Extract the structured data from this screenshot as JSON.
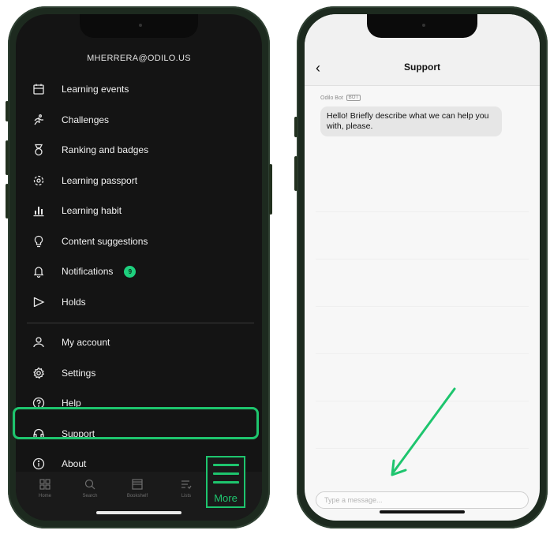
{
  "left_screen": {
    "account_email": "MHERRERA@ODILO.US",
    "menu_items": [
      {
        "label": "Learning events",
        "icon": "calendar-icon"
      },
      {
        "label": "Challenges",
        "icon": "runner-icon"
      },
      {
        "label": "Ranking and badges",
        "icon": "medal-icon"
      },
      {
        "label": "Learning passport",
        "icon": "passport-icon"
      },
      {
        "label": "Learning habit",
        "icon": "bar-chart-icon"
      },
      {
        "label": "Content suggestions",
        "icon": "lightbulb-icon"
      },
      {
        "label": "Notifications",
        "icon": "bell-icon",
        "badge": "9"
      },
      {
        "label": "Holds",
        "icon": "flag-icon"
      }
    ],
    "account_items": [
      {
        "label": "My account",
        "icon": "user-icon"
      },
      {
        "label": "Settings",
        "icon": "gear-icon"
      },
      {
        "label": "Help",
        "icon": "help-icon"
      },
      {
        "label": "Support",
        "icon": "headset-icon"
      },
      {
        "label": "About",
        "icon": "info-icon"
      }
    ],
    "tabs": [
      {
        "label": "Home",
        "icon": "home-grid-icon"
      },
      {
        "label": "Search",
        "icon": "search-icon"
      },
      {
        "label": "Bookshelf",
        "icon": "bookshelf-icon"
      },
      {
        "label": "Lists",
        "icon": "lists-icon"
      }
    ],
    "more_tab": {
      "label": "More",
      "icon": "hamburger-icon"
    },
    "accent_color": "#1ec56e"
  },
  "right_screen": {
    "title": "Support",
    "sender_name": "Odilo Bot",
    "sender_tag": "BOT",
    "message": "Hello! Briefly describe what we can help you with, please.",
    "input_placeholder": "Type a message..."
  }
}
